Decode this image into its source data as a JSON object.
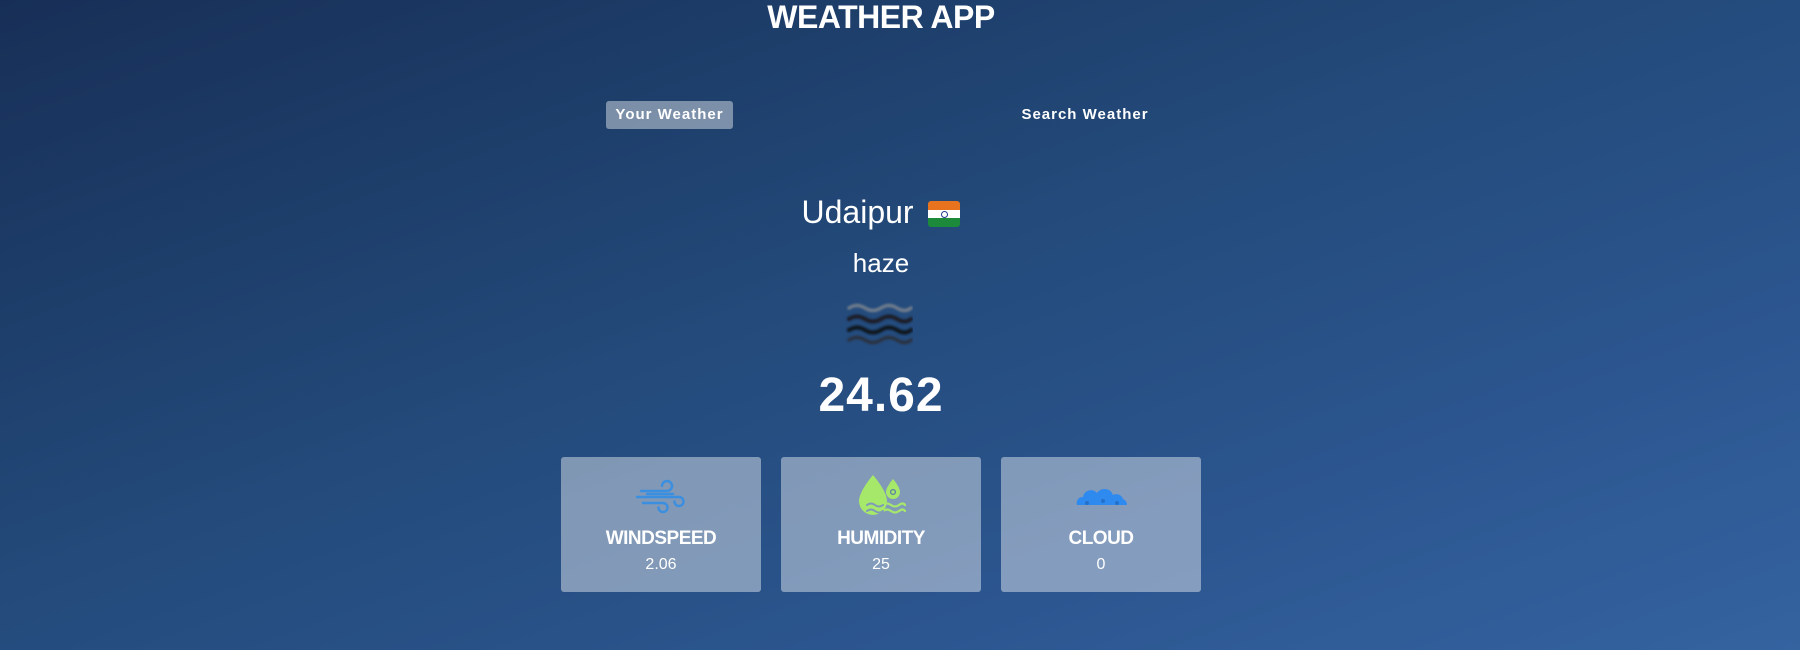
{
  "header": {
    "title": "WEATHER APP"
  },
  "tabs": {
    "your_weather": "Your Weather",
    "search_weather": "Search Weather",
    "active": "Your Weather"
  },
  "weather": {
    "city": "Udaipur",
    "country_flag_icon": "india-flag-icon",
    "description": "haze",
    "condition_icon": "haze-icon",
    "temperature": "24.62"
  },
  "stats": {
    "windspeed": {
      "label": "WINDSPEED",
      "value": "2.06",
      "icon": "wind-icon",
      "icon_color": "#3a8fe0"
    },
    "humidity": {
      "label": "HUMIDITY",
      "value": "25",
      "icon": "humidity-drop-icon",
      "icon_color": "#a6e86a"
    },
    "cloud": {
      "label": "CLOUD",
      "value": "0",
      "icon": "cloud-icon",
      "icon_color": "#2f8af0"
    }
  },
  "colors": {
    "background_start": "#172f57",
    "background_end": "#3463a0",
    "card_background": "rgba(255,255,255,0.42)"
  }
}
